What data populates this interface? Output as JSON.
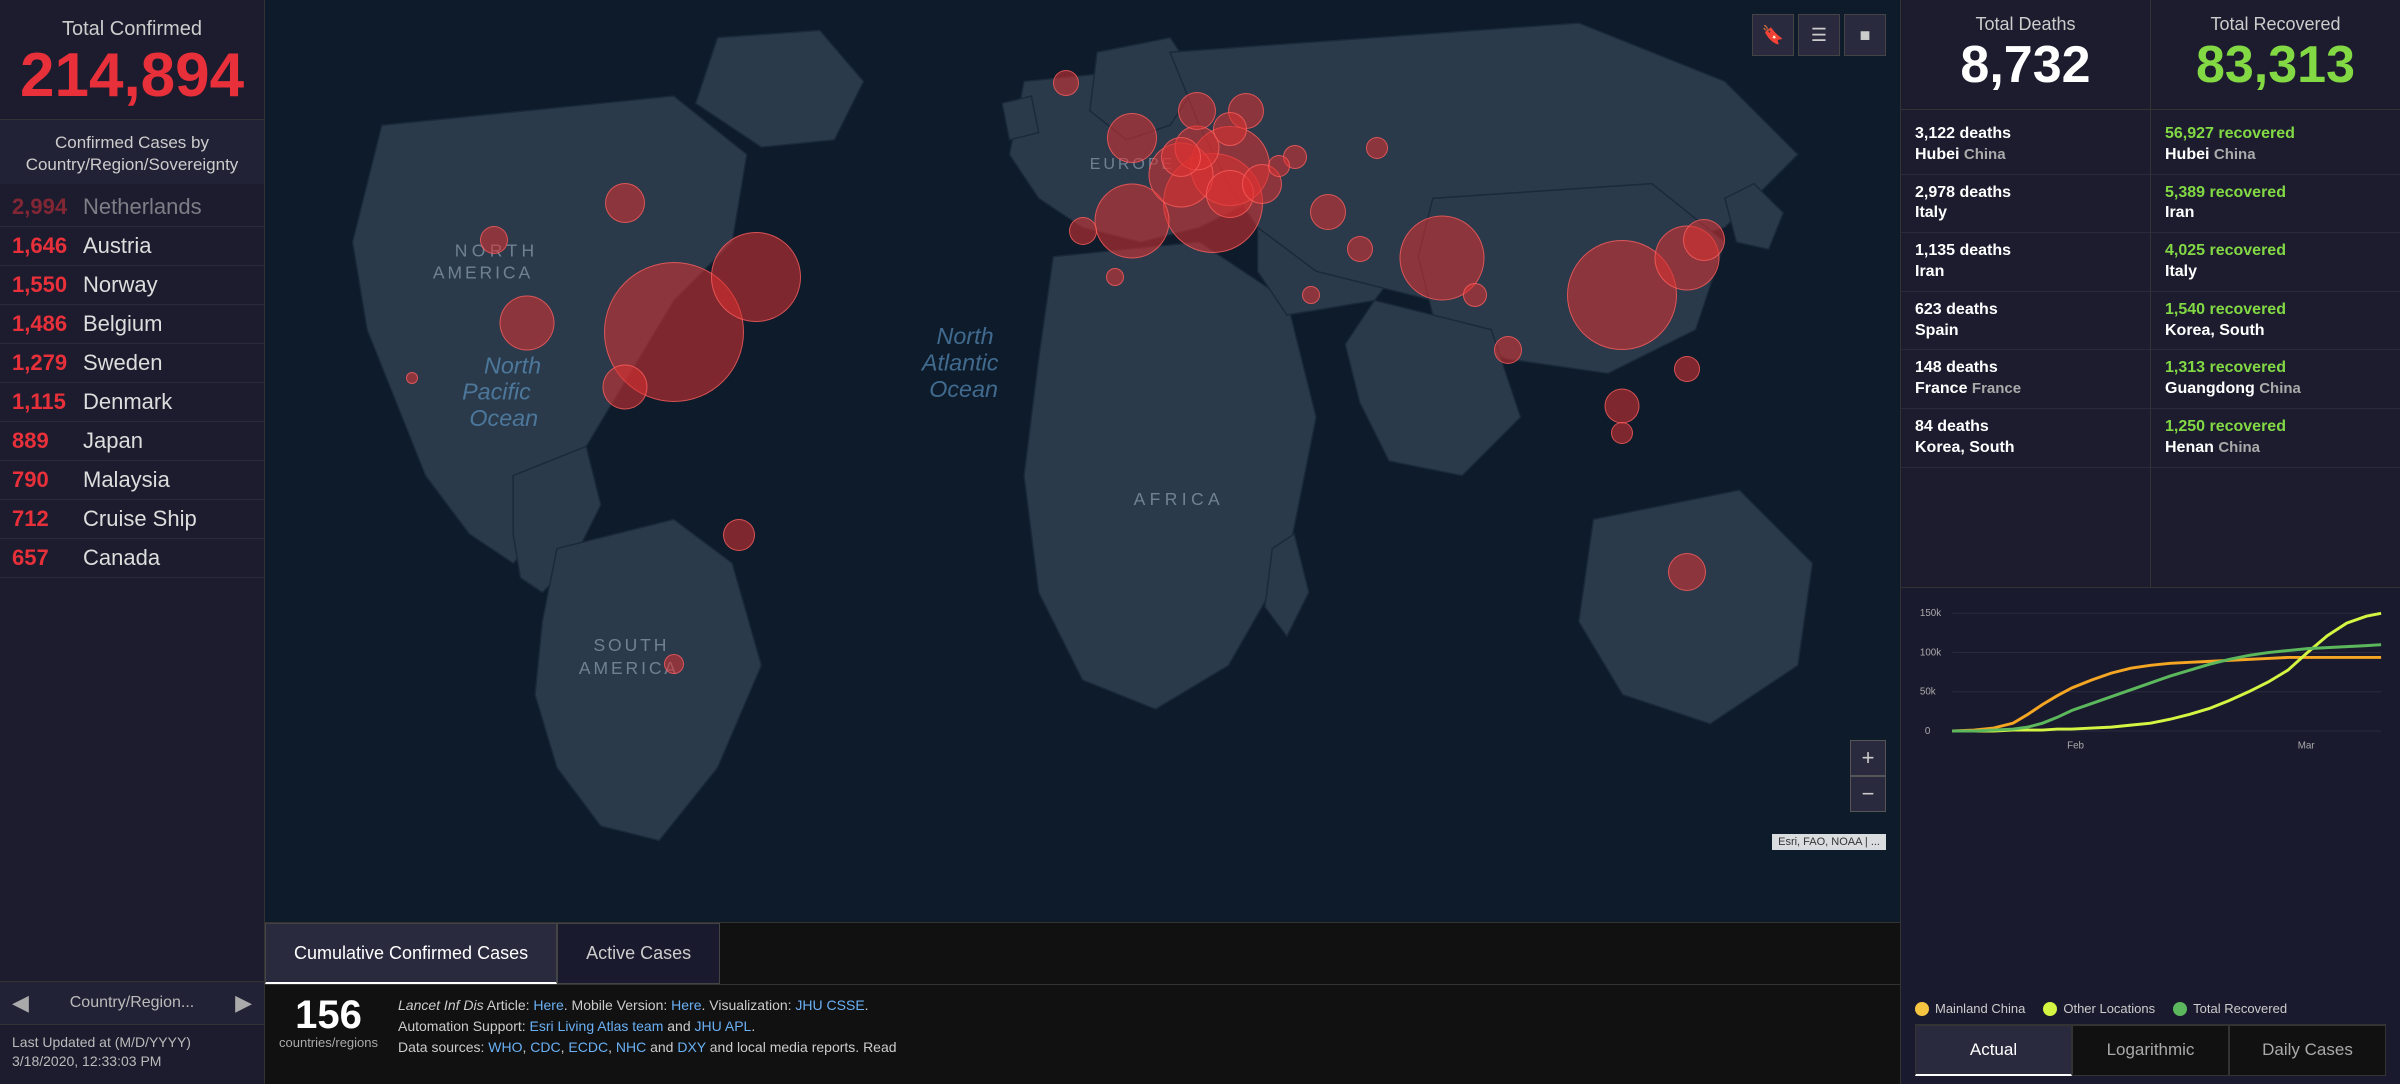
{
  "sidebar": {
    "total_confirmed_label": "Total Confirmed",
    "total_confirmed_value": "214,894",
    "cases_by_country_title": "Confirmed Cases by Country/Region/Sovereignty",
    "country_list": [
      {
        "count": "2,994",
        "name": "Netherlands",
        "faded": true
      },
      {
        "count": "1,646",
        "name": "Austria",
        "faded": false
      },
      {
        "count": "1,550",
        "name": "Norway",
        "faded": false
      },
      {
        "count": "1,486",
        "name": "Belgium",
        "faded": false
      },
      {
        "count": "1,279",
        "name": "Sweden",
        "faded": false
      },
      {
        "count": "1,115",
        "name": "Denmark",
        "faded": false
      },
      {
        "count": "889",
        "name": "Japan",
        "faded": false
      },
      {
        "count": "790",
        "name": "Malaysia",
        "faded": false
      },
      {
        "count": "712",
        "name": "Cruise Ship",
        "faded": false
      },
      {
        "count": "657",
        "name": "Canada",
        "faded": false
      }
    ],
    "nav_label": "Country/Region...",
    "last_updated_label": "Last Updated at (M/D/YYYY)",
    "last_updated_value": "3/18/2020, 12:33:03 PM"
  },
  "map": {
    "ocean_labels": [
      {
        "text": "North Pacific Ocean",
        "left": "13%",
        "top": "40%"
      },
      {
        "text": "North Atlantic Ocean",
        "left": "54%",
        "top": "37%"
      }
    ],
    "continent_labels": [
      {
        "text": "NORTH AMERICA",
        "left": "19%",
        "top": "27%"
      },
      {
        "text": "SOUTH AMERICA",
        "left": "27%",
        "top": "62%"
      },
      {
        "text": "AFRICA",
        "left": "52%",
        "top": "56%"
      },
      {
        "text": "EUROPE",
        "left": "52%",
        "top": "17%"
      }
    ],
    "zoom_plus": "+",
    "zoom_minus": "−",
    "esri_attribution": "Esri, FAO, NOAA | ...",
    "tabs": [
      "Cumulative Confirmed Cases",
      "Active Cases"
    ],
    "active_tab": "Cumulative Confirmed Cases"
  },
  "bottom_bar": {
    "countries_count": "156",
    "countries_label": "countries/regions",
    "description_parts": [
      {
        "text": "Lancet Inf Dis",
        "type": "italic"
      },
      {
        "text": " Article: ",
        "type": "plain"
      },
      {
        "text": "Here",
        "type": "link"
      },
      {
        "text": ". Mobile Version: ",
        "type": "plain"
      },
      {
        "text": "Here",
        "type": "link"
      },
      {
        "text": ". Visualization: ",
        "type": "plain"
      },
      {
        "text": "JHU CSSE",
        "type": "link"
      },
      {
        "text": ".",
        "type": "plain"
      },
      {
        "text": "\nAutomation Support: ",
        "type": "plain"
      },
      {
        "text": "Esri Living Atlas team",
        "type": "link"
      },
      {
        "text": " and ",
        "type": "plain"
      },
      {
        "text": "JHU APL",
        "type": "link"
      },
      {
        "text": ".",
        "type": "plain"
      },
      {
        "text": "\nData sources: ",
        "type": "plain"
      },
      {
        "text": "WHO",
        "type": "link"
      },
      {
        "text": ", ",
        "type": "plain"
      },
      {
        "text": "CDC",
        "type": "link"
      },
      {
        "text": ", ",
        "type": "plain"
      },
      {
        "text": "ECDC",
        "type": "link"
      },
      {
        "text": ", ",
        "type": "plain"
      },
      {
        "text": "NHC",
        "type": "link"
      },
      {
        "text": " and ",
        "type": "plain"
      },
      {
        "text": "DXY",
        "type": "link"
      },
      {
        "text": " and local media reports. Read",
        "type": "plain"
      }
    ]
  },
  "right_panel": {
    "total_deaths_label": "Total Deaths",
    "total_deaths_value": "8,732",
    "total_recovered_label": "Total Recovered",
    "total_recovered_value": "83,313",
    "deaths_list": [
      {
        "count": "3,122 deaths",
        "region": "Hubei",
        "country": "China"
      },
      {
        "count": "2,978 deaths",
        "region": "Italy",
        "country": ""
      },
      {
        "count": "1,135 deaths",
        "region": "Iran",
        "country": ""
      },
      {
        "count": "623 deaths",
        "region": "Spain",
        "country": ""
      },
      {
        "count": "148 deaths",
        "region": "France",
        "country": "France"
      },
      {
        "count": "84 deaths",
        "region": "Korea, South",
        "country": ""
      }
    ],
    "recovered_list": [
      {
        "count": "56,927 recovered",
        "region": "Hubei",
        "country": "China"
      },
      {
        "count": "5,389 recovered",
        "region": "Iran",
        "country": ""
      },
      {
        "count": "4,025 recovered",
        "region": "Italy",
        "country": ""
      },
      {
        "count": "1,540 recovered",
        "region": "Korea, South",
        "country": ""
      },
      {
        "count": "1,313 recovered",
        "region": "Guangdong",
        "country": "China"
      },
      {
        "count": "1,250 recovered",
        "region": "Henan",
        "country": "China"
      }
    ]
  },
  "chart": {
    "y_labels": [
      "150k",
      "100k",
      "50k",
      "0"
    ],
    "x_labels": [
      "",
      "Feb",
      "",
      "Mar"
    ],
    "legend": [
      {
        "color": "#f5c542",
        "label": "Mainland China"
      },
      {
        "color": "#d4f542",
        "label": "Other Locations"
      },
      {
        "color": "#5cb85c",
        "label": "Total Recovered"
      }
    ],
    "tabs": [
      "Actual",
      "Logarithmic",
      "Daily Cases"
    ],
    "active_tab": "Actual"
  }
}
